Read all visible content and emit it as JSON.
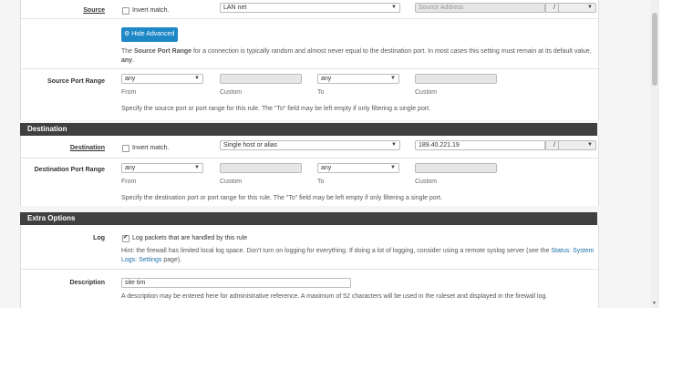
{
  "source": {
    "label": "Source",
    "invert_label": "Invert match.",
    "network_value": "LAN net",
    "address_placeholder": "Source Address",
    "slash": "/",
    "hide_advanced_label": "Hide Advanced",
    "help_pre": "The ",
    "help_bold": "Source Port Range",
    "help_post": " for a connection is typically random and almost never equal to the destination port. In most cases this setting must remain at its default value, ",
    "help_any": "any",
    "help_end": "."
  },
  "source_port": {
    "label": "Source Port Range",
    "from_value": "any",
    "to_value": "any",
    "from_label": "From",
    "custom_label": "Custom",
    "to_label": "To",
    "custom2_label": "Custom",
    "help": "Specify the source port or port range for this rule. The \"To\" field may be left empty if only filtering a single port."
  },
  "destination_section": {
    "title": "Destination"
  },
  "destination": {
    "label": "Destination",
    "invert_label": "Invert match.",
    "type_value": "Single host or alias",
    "address_value": "189.40.221.19",
    "slash": "/"
  },
  "destination_port": {
    "label": "Destination Port Range",
    "from_value": "any",
    "to_value": "any",
    "from_label": "From",
    "custom_label": "Custom",
    "to_label": "To",
    "custom2_label": "Custom",
    "help": "Specify the destination port or port range for this rule. The \"To\" field may be left empty if only filtering a single port."
  },
  "extra_section": {
    "title": "Extra Options"
  },
  "log": {
    "label": "Log",
    "checked": true,
    "checkbox_label": "Log packets that are handled by this rule",
    "hint": "Hint: the firewall has limited local log space. Don't turn on logging for everything. If doing a lot of logging, consider using a remote syslog server (see the ",
    "hint_link": "Status: System Logs: Settings",
    "hint_end": " page)."
  },
  "description": {
    "label": "Description",
    "value": "site tim",
    "help": "A description may be entered here for administrative reference. A maximum of 52 characters will be used in the ruleset and displayed in the firewall log."
  },
  "colors": {
    "accent": "#1e88c7",
    "section_bar": "#404040",
    "link": "#1e6fa8"
  }
}
